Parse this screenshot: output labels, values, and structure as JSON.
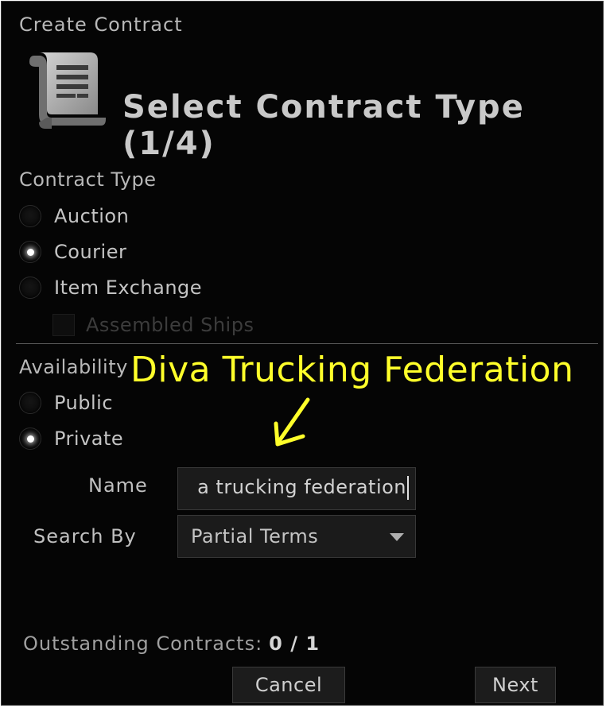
{
  "window": {
    "title": "Create Contract"
  },
  "header": {
    "step_title": "Select Contract Type (1/4)",
    "icon": "contract-scroll-icon"
  },
  "contract_type": {
    "label": "Contract Type",
    "options": [
      {
        "label": "Auction",
        "checked": false
      },
      {
        "label": "Courier",
        "checked": true
      },
      {
        "label": "Item Exchange",
        "checked": false
      }
    ],
    "assembled_ships": {
      "label": "Assembled Ships",
      "checked": false,
      "disabled": true
    }
  },
  "availability": {
    "label": "Availability",
    "options": [
      {
        "label": "Public",
        "checked": false
      },
      {
        "label": "Private",
        "checked": true
      }
    ]
  },
  "annotation": {
    "text": "Diva Trucking Federation",
    "color": "#ffff2a"
  },
  "name_field": {
    "label": "Name",
    "value": "a trucking federation"
  },
  "search_by": {
    "label": "Search By",
    "selected": "Partial Terms"
  },
  "outstanding": {
    "label": "Outstanding Contracts:",
    "value": "0 / 1"
  },
  "buttons": {
    "cancel": "Cancel",
    "next": "Next"
  }
}
